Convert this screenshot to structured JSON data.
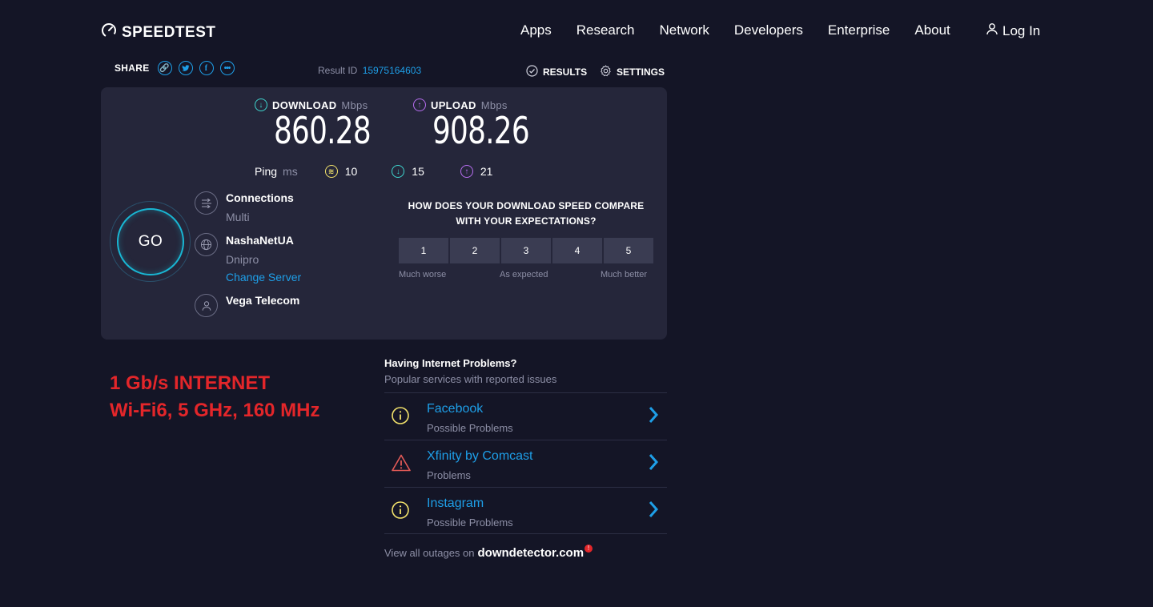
{
  "header": {
    "logo_text": "SPEEDTEST",
    "nav": [
      "Apps",
      "Research",
      "Network",
      "Developers",
      "Enterprise",
      "About"
    ],
    "login_label": "Log In"
  },
  "share": {
    "label": "SHARE",
    "icons": [
      "link-icon",
      "twitter-icon",
      "facebook-icon",
      "more-icon"
    ]
  },
  "result": {
    "label": "Result ID",
    "id": "15975164603"
  },
  "actions": {
    "results_label": "RESULTS",
    "settings_label": "SETTINGS"
  },
  "download": {
    "label": "DOWNLOAD",
    "unit": "Mbps",
    "value": "860.28"
  },
  "upload": {
    "label": "UPLOAD",
    "unit": "Mbps",
    "value": "908.26"
  },
  "ping": {
    "label": "Ping",
    "unit": "ms",
    "idle": "10",
    "download": "15",
    "upload": "21"
  },
  "go_label": "GO",
  "connections": {
    "title": "Connections",
    "value": "Multi"
  },
  "server": {
    "name": "NashaNetUA",
    "city": "Dnipro",
    "change_label": "Change Server"
  },
  "provider": {
    "name": "Vega Telecom"
  },
  "survey": {
    "question_line1": "HOW DOES YOUR DOWNLOAD SPEED COMPARE",
    "question_line2": "WITH YOUR EXPECTATIONS?",
    "options": [
      "1",
      "2",
      "3",
      "4",
      "5"
    ],
    "low_label": "Much worse",
    "mid_label": "As expected",
    "high_label": "Much better"
  },
  "annotation": {
    "line1": "1 Gb/s INTERNET",
    "line2": "Wi-Fi6, 5 GHz, 160 MHz"
  },
  "problems": {
    "heading": "Having Internet Problems?",
    "subheading": "Popular services with reported issues",
    "items": [
      {
        "name": "Facebook",
        "status": "Possible Problems",
        "icon": "info-icon"
      },
      {
        "name": "Xfinity by Comcast",
        "status": "Problems",
        "icon": "warning-icon"
      },
      {
        "name": "Instagram",
        "status": "Possible Problems",
        "icon": "info-icon"
      }
    ],
    "footer_text": "View all outages on",
    "footer_link": "downdetector.com"
  },
  "colors": {
    "background": "#141526",
    "card": "#25263a",
    "accent_blue": "#1e9fe8",
    "download_teal": "#3fd6cf",
    "upload_purple": "#b76ef0",
    "ping_yellow": "#f2e26b",
    "annotation_red": "#e3262a"
  }
}
